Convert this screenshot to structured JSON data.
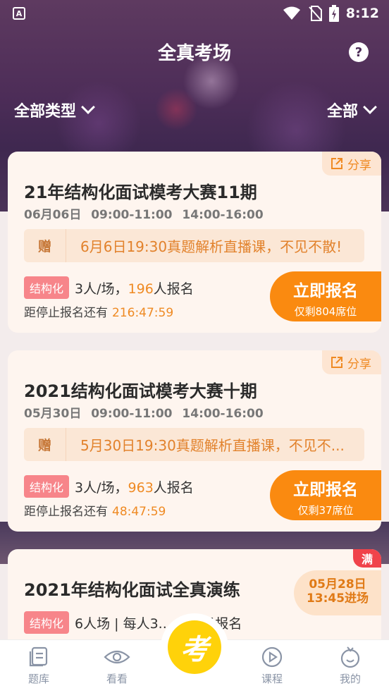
{
  "status_bar": {
    "left_icon": "A",
    "time": "8:12",
    "icons": [
      "wifi-icon",
      "no-sim-icon",
      "battery-charging-icon"
    ]
  },
  "header": {
    "title": "全真考场",
    "help": "?"
  },
  "filters": {
    "type_label": "全部类型",
    "status_label": "全部"
  },
  "cards": [
    {
      "share_label": "分享",
      "title": "21年结构化面试模考大赛11期",
      "date_line": "06月06日 09:00-11:00 14:00-16:00",
      "gift_badge": "赠",
      "gift_text": "6月6日19:30真题解析直播课，不见不散!",
      "tag": "结构化",
      "per_room": "3人/场，",
      "enrolled_count": "196",
      "enrolled_suffix": "人报名",
      "countdown_label": "距停止报名还有",
      "countdown_value": "216:47:59",
      "signup_label": "立即报名",
      "seats_left": "仅剩804席位"
    },
    {
      "share_label": "分享",
      "title": "2021结构化面试模考大赛十期",
      "date_line": "05月30日 09:00-11:00 14:00-16:00",
      "gift_badge": "赠",
      "gift_text": "5月30日19:30真题解析直播课，不见不...",
      "tag": "结构化",
      "per_room": "3人/场，",
      "enrolled_count": "963",
      "enrolled_suffix": "人报名",
      "countdown_label": "距停止报名还有",
      "countdown_value": "48:47:59",
      "signup_label": "立即报名",
      "seats_left": "仅剩37席位"
    },
    {
      "full_badge": "满",
      "title": "2021年结构化面试全真演练",
      "entry_date": "05月28日",
      "entry_time": "13:45进场",
      "tag": "结构化",
      "meta_text": "6人场 | 每人3... /6人已报名"
    }
  ],
  "tabbar": {
    "items": [
      {
        "label": "题库",
        "icon": "question-bank-icon"
      },
      {
        "label": "看看",
        "icon": "eye-icon"
      },
      {
        "label": "考",
        "icon": "exam-icon"
      },
      {
        "label": "课程",
        "icon": "play-circle-icon"
      },
      {
        "label": "我的",
        "icon": "profile-icon"
      }
    ]
  },
  "colors": {
    "accent": "#fa8a10",
    "tag": "#f7858a",
    "header_bg": "#4d2d58",
    "exam_yellow": "#ffd20a",
    "full_red": "#f0434b"
  }
}
